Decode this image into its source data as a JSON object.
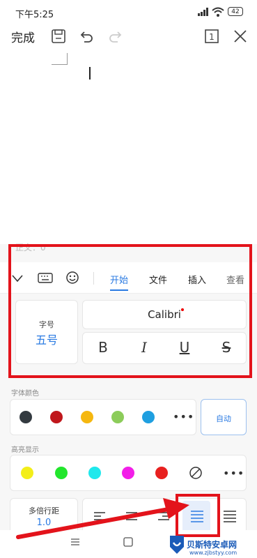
{
  "status_bar": {
    "time": "下午5:25",
    "battery": "42"
  },
  "toolbar": {
    "done_label": "完成"
  },
  "style_hint": "正文：0",
  "tabs": [
    "开始",
    "文件",
    "插入",
    "查看"
  ],
  "font": {
    "size_label": "字号",
    "size_value": "五号",
    "name": "Calibri"
  },
  "format_buttons": {
    "bold": "B",
    "italic": "I",
    "underline": "U",
    "strike": "S"
  },
  "font_color": {
    "label": "字体颜色",
    "colors": [
      "#333a40",
      "#c0171c",
      "#f5b70f",
      "#8ccc5a",
      "#1f9fe0"
    ],
    "auto_label": "自动"
  },
  "highlight": {
    "label": "高亮显示",
    "colors": [
      "#f3ee19",
      "#22e62c",
      "#1fe8ec",
      "#f21ee8",
      "#e8201f"
    ]
  },
  "spacing": {
    "label": "多倍行距",
    "value": "1.0"
  },
  "watermark": {
    "title": "贝斯特安卓网",
    "url": "www.zjbstyy.com"
  }
}
